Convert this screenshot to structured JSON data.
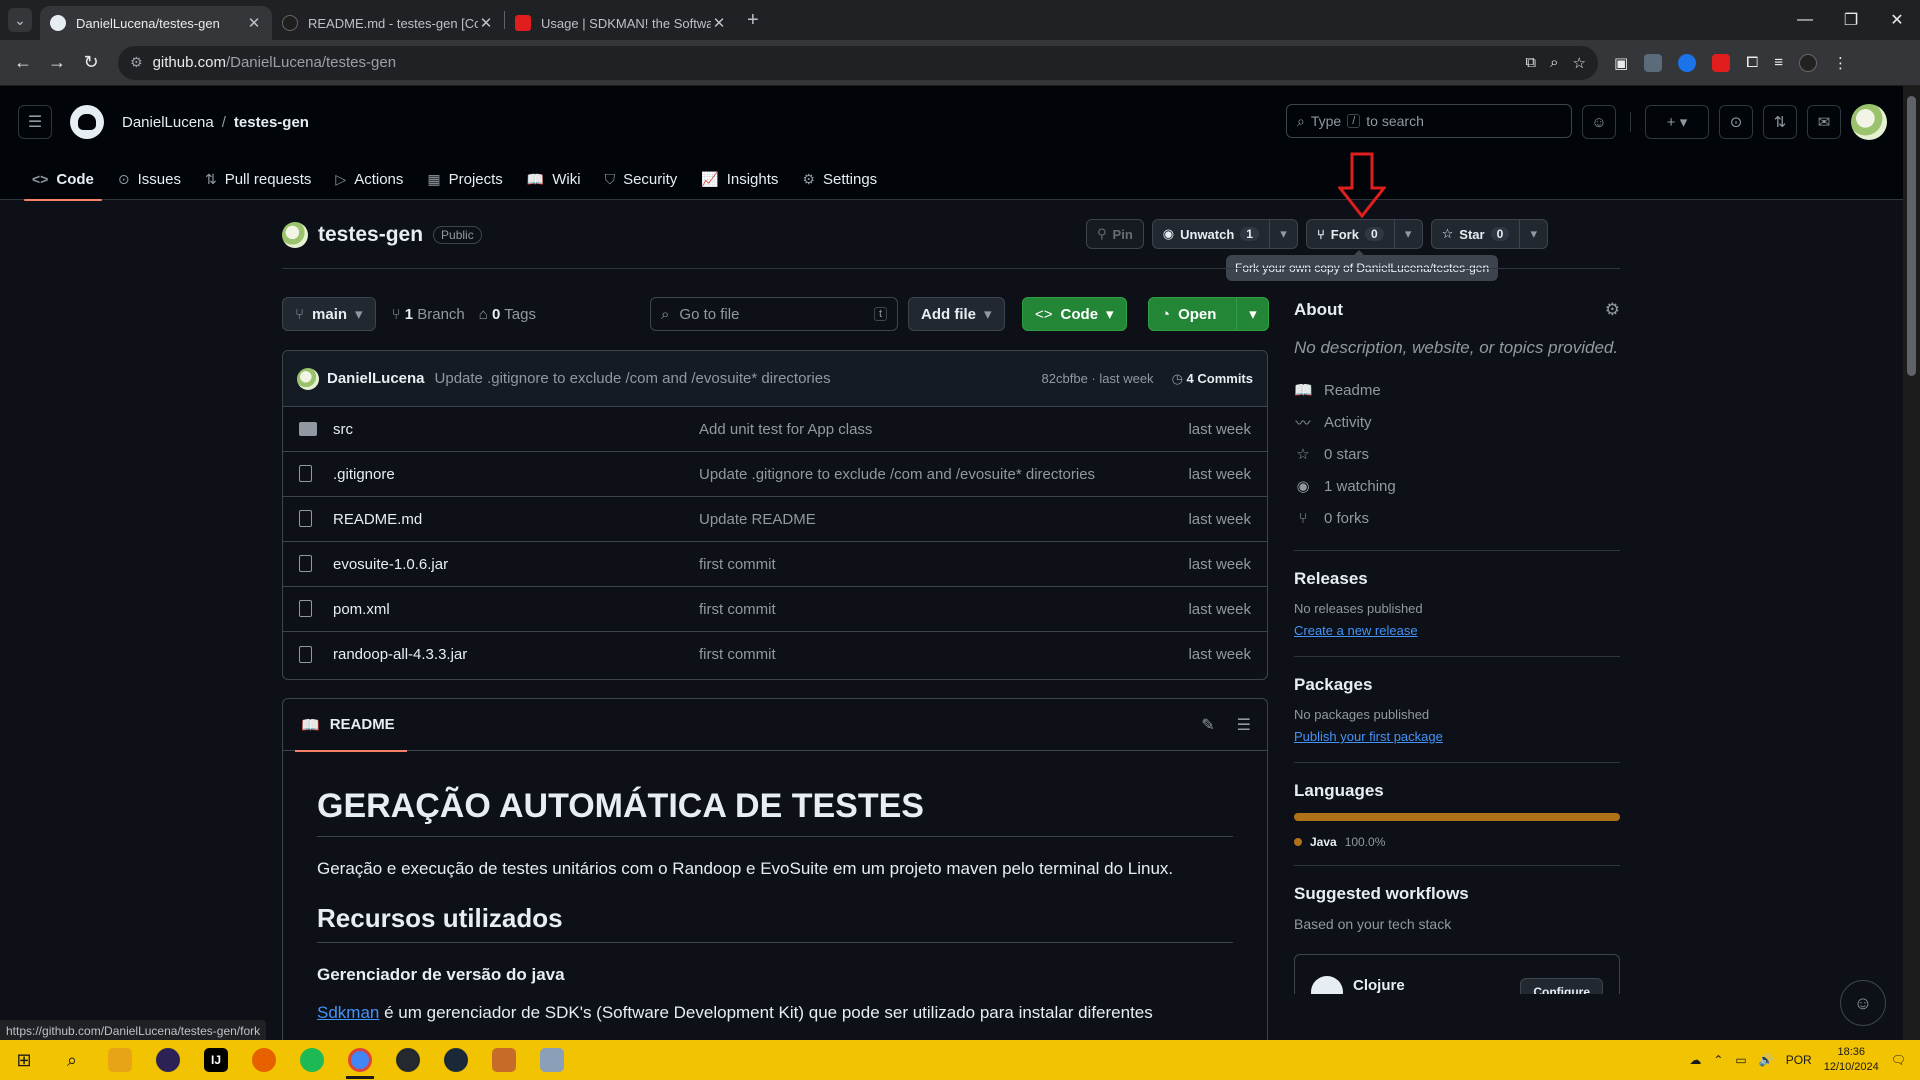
{
  "browser": {
    "tabs": [
      {
        "title": "DanielLucena/testes-gen",
        "active": true,
        "favicon_color": "#e6edf3"
      },
      {
        "title": "README.md - testes-gen [Code",
        "active": false,
        "favicon_color": "#1f1f1f"
      },
      {
        "title": "Usage | SDKMAN! the Software",
        "active": false,
        "favicon_color": "#e01e1e"
      }
    ],
    "url_host": "github.com",
    "url_path": "/DanielLucena/testes-gen"
  },
  "header": {
    "owner": "DanielLucena",
    "separator": "/",
    "repo": "testes-gen",
    "search_pre": "Type",
    "search_key": "/",
    "search_post": "to search"
  },
  "repo_tabs": [
    {
      "label": "Code",
      "icon": "code-icon",
      "glyph": "<>",
      "active": true
    },
    {
      "label": "Issues",
      "icon": "issue-icon",
      "glyph": "⊙"
    },
    {
      "label": "Pull requests",
      "icon": "pull-request-icon",
      "glyph": "⇅"
    },
    {
      "label": "Actions",
      "icon": "play-icon",
      "glyph": "▷"
    },
    {
      "label": "Projects",
      "icon": "table-icon",
      "glyph": "▦"
    },
    {
      "label": "Wiki",
      "icon": "book-icon",
      "glyph": "📖"
    },
    {
      "label": "Security",
      "icon": "shield-icon",
      "glyph": "⛉"
    },
    {
      "label": "Insights",
      "icon": "graph-icon",
      "glyph": "📈"
    },
    {
      "label": "Settings",
      "icon": "gear-icon",
      "glyph": "⚙"
    }
  ],
  "repo": {
    "name": "testes-gen",
    "visibility": "Public",
    "pin": "Pin",
    "unwatch": "Unwatch",
    "watch_count": "1",
    "fork": "Fork",
    "fork_count": "0",
    "star": "Star",
    "star_count": "0",
    "tooltip": "Fork your own copy of DanielLucena/testes-gen"
  },
  "branchbar": {
    "branch": "main",
    "branch_count": "1",
    "branch_label": "Branch",
    "tag_count": "0",
    "tag_label": "Tags",
    "goto_placeholder": "Go to file",
    "goto_key": "t",
    "add_file": "Add file",
    "code": "Code",
    "open": "Open"
  },
  "commit": {
    "author": "DanielLucena",
    "message": "Update .gitignore to exclude /com and /evosuite* directories",
    "hash_time": "82cbfbe · last week",
    "commits": "4 Commits"
  },
  "files": [
    {
      "name": "src",
      "type": "folder",
      "message": "Add unit test for App class",
      "date": "last week"
    },
    {
      "name": ".gitignore",
      "type": "file",
      "message": "Update .gitignore to exclude /com and /evosuite* directories",
      "date": "last week"
    },
    {
      "name": "README.md",
      "type": "file",
      "message": "Update README",
      "date": "last week"
    },
    {
      "name": "evosuite-1.0.6.jar",
      "type": "file",
      "message": "first commit",
      "date": "last week"
    },
    {
      "name": "pom.xml",
      "type": "file",
      "message": "first commit",
      "date": "last week"
    },
    {
      "name": "randoop-all-4.3.3.jar",
      "type": "file",
      "message": "first commit",
      "date": "last week"
    }
  ],
  "readme": {
    "tab": "README",
    "h1": "GERAÇÃO AUTOMÁTICA DE TESTES",
    "p1": "Geração e execução de testes unitários com o Randoop e EvoSuite em um projeto maven pelo terminal do Linux.",
    "h2": "Recursos utilizados",
    "h4": "Gerenciador de versão do java",
    "link": "Sdkman",
    "p2": " é um gerenciador de SDK's (Software Development Kit) que pode ser utilizado para instalar diferentes"
  },
  "sidebar": {
    "about_title": "About",
    "description": "No description, website, or topics provided.",
    "items": [
      {
        "label": "Readme",
        "icon": "book-icon",
        "glyph": "📖"
      },
      {
        "label": "Activity",
        "icon": "pulse-icon",
        "glyph": "〰"
      },
      {
        "label": "0 stars",
        "icon": "star-icon",
        "glyph": "☆"
      },
      {
        "label": "1 watching",
        "icon": "eye-icon",
        "glyph": "◉"
      },
      {
        "label": "0 forks",
        "icon": "fork-icon",
        "glyph": "⑂"
      }
    ],
    "releases_title": "Releases",
    "releases_text": "No releases published",
    "releases_link": "Create a new release",
    "packages_title": "Packages",
    "packages_text": "No packages published",
    "packages_link": "Publish your first package",
    "languages_title": "Languages",
    "language_name": "Java",
    "language_pct": "100.0%",
    "language_share": 1.0,
    "workflows_title": "Suggested workflows",
    "workflows_sub": "Based on your tech stack",
    "workflow_name": "Clojure",
    "workflow_btn": "Configure"
  },
  "status_url": "https://github.com/DanielLucena/testes-gen/fork",
  "taskbar": {
    "lang": "POR",
    "time": "18:36",
    "date": "12/10/2024"
  },
  "colors": {
    "accent_green": "#238636",
    "tab_underline": "#f78166",
    "java": "#b07219",
    "taskbar": "#f2c300",
    "arrow": "#e01e1e"
  }
}
